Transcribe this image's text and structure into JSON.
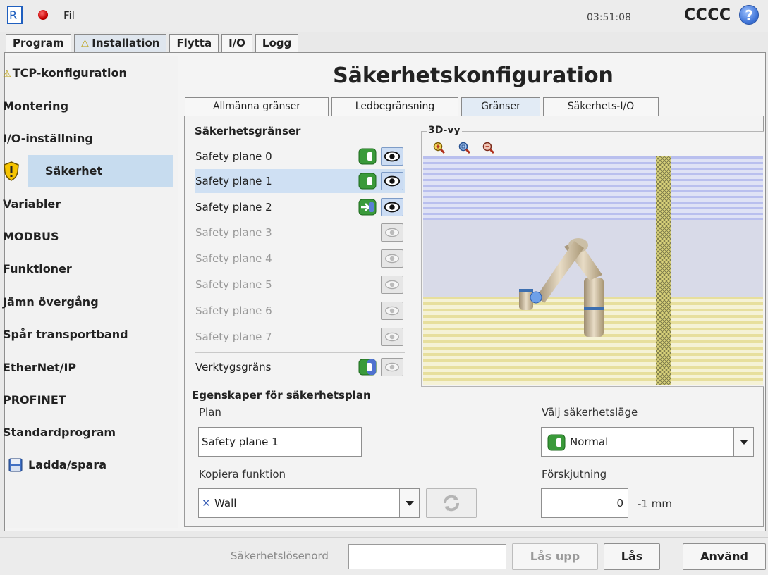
{
  "topbar": {
    "file_label": "Fil",
    "clock": "03:51:08",
    "robot_name": "CCCC",
    "help_glyph": "?"
  },
  "main_tabs": [
    {
      "label": "Program"
    },
    {
      "label": "Installation",
      "warning": true,
      "active": true
    },
    {
      "label": "Flytta"
    },
    {
      "label": "I/O"
    },
    {
      "label": "Logg"
    }
  ],
  "sidebar": {
    "items": [
      {
        "label": "TCP-konfiguration",
        "warning": true
      },
      {
        "label": "Montering"
      },
      {
        "label": "I/O-inställning"
      },
      {
        "label": "Säkerhet",
        "active": true,
        "icon": "shield-warning-icon"
      },
      {
        "label": "Variabler"
      },
      {
        "label": "MODBUS"
      },
      {
        "label": "Funktioner"
      },
      {
        "label": "Jämn övergång"
      },
      {
        "label": "Spår transportband"
      },
      {
        "label": "EtherNet/IP"
      },
      {
        "label": "PROFINET"
      },
      {
        "label": "Standardprogram"
      },
      {
        "label": "Ladda/spara",
        "icon": "floppy-disk-icon"
      }
    ]
  },
  "page_title": "Säkerhetskonfiguration",
  "sub_tabs": [
    {
      "label": "Allmänna gränser"
    },
    {
      "label": "Ledbegränsning"
    },
    {
      "label": "Gränser",
      "active": true
    },
    {
      "label": "Säkerhets-I/O"
    }
  ],
  "limits": {
    "title": "Säkerhetsgränser",
    "planes": [
      {
        "label": "Safety plane 0",
        "enabled": true,
        "mode": "normal",
        "visible": true
      },
      {
        "label": "Safety plane 1",
        "enabled": true,
        "mode": "normal",
        "visible": true,
        "selected": true
      },
      {
        "label": "Safety plane 2",
        "enabled": true,
        "mode": "trigger",
        "visible": true
      },
      {
        "label": "Safety plane 3",
        "enabled": false,
        "visible": false
      },
      {
        "label": "Safety plane 4",
        "enabled": false,
        "visible": false
      },
      {
        "label": "Safety plane 5",
        "enabled": false,
        "visible": false
      },
      {
        "label": "Safety plane 6",
        "enabled": false,
        "visible": false
      },
      {
        "label": "Safety plane 7",
        "enabled": false,
        "visible": false
      }
    ],
    "tool_limit": {
      "label": "Verktygsgräns",
      "mode": "both",
      "visible": false
    }
  },
  "view3d": {
    "label": "3D-vy",
    "zoom_buttons": [
      "zoom-in-icon",
      "zoom-fit-icon",
      "zoom-out-icon"
    ]
  },
  "properties": {
    "title": "Egenskaper för säkerhetsplan",
    "plan_label": "Plan",
    "plan_value": "Safety plane 1",
    "copy_label": "Kopiera funktion",
    "copy_value": "Wall",
    "mode_label": "Välj säkerhetsläge",
    "mode_value": "Normal",
    "offset_label": "Förskjutning",
    "offset_value": "0",
    "offset_unit": "-1 mm"
  },
  "bottombar": {
    "password_label": "Säkerhetslösenord",
    "unlock_label": "Lås upp",
    "lock_label": "Lås",
    "apply_label": "Använd"
  },
  "colors": {
    "accent_green": "#2e8b2e",
    "selection_blue": "#cfe0f3",
    "plane_violet": "#b7bff0",
    "plane_yellow": "#e9e2a8"
  }
}
